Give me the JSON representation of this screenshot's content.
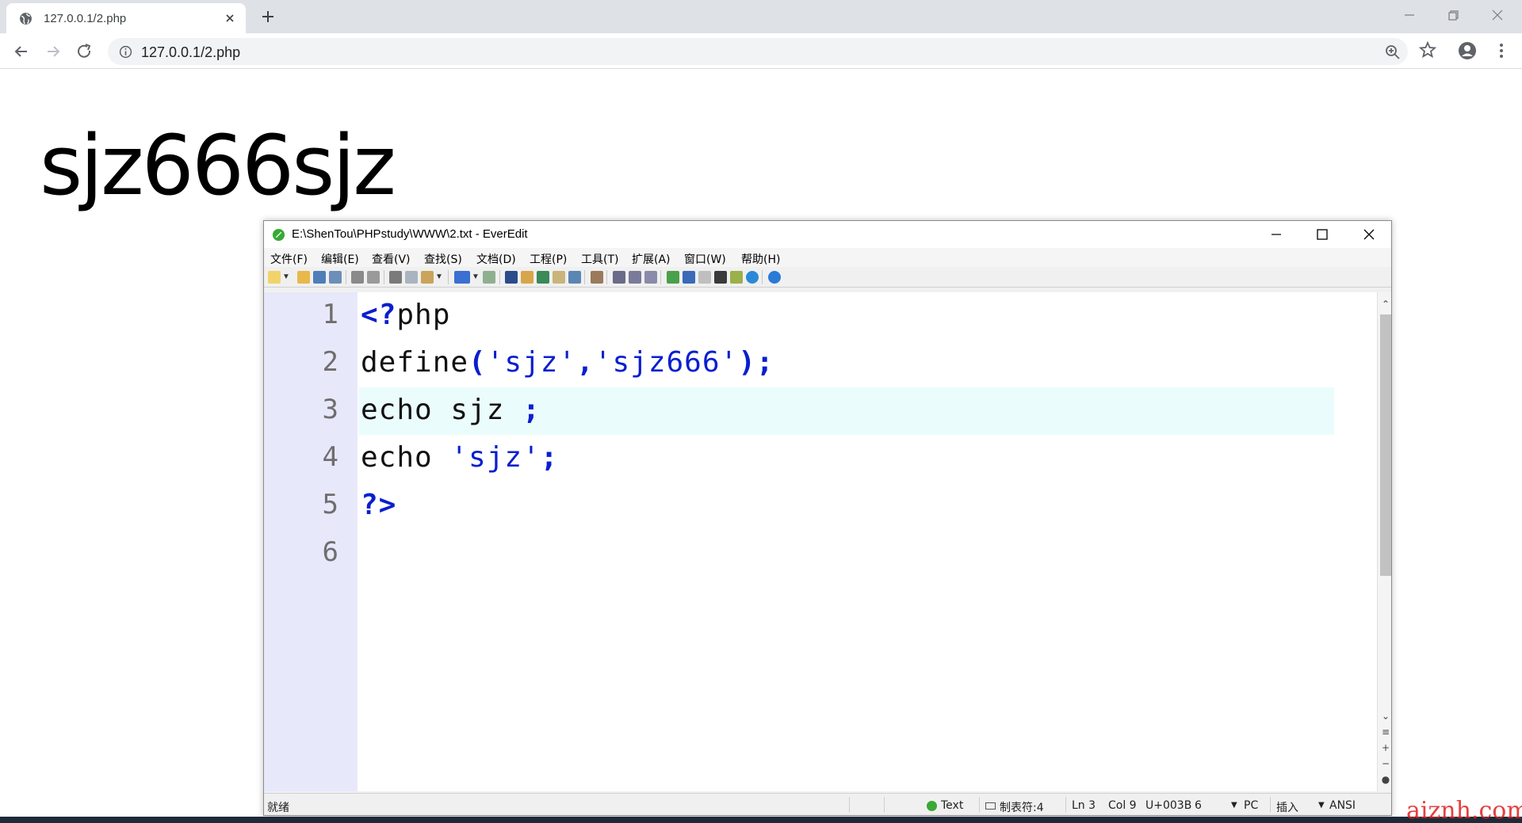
{
  "browser": {
    "tab_title": "127.0.0.1/2.php",
    "url": "127.0.0.1/2.php"
  },
  "page": {
    "output": "sjz666sjz"
  },
  "editor": {
    "title": "E:\\ShenTou\\PHPstudy\\WWW\\2.txt - EverEdit",
    "menu": [
      "文件(F)",
      "编辑(E)",
      "查看(V)",
      "查找(S)",
      "文档(D)",
      "工程(P)",
      "工具(T)",
      "扩展(A)",
      "窗口(W)",
      "帮助(H)"
    ],
    "line_numbers": [
      "1",
      "2",
      "3",
      "4",
      "5",
      "6"
    ],
    "code": {
      "l1_open": "<?",
      "l1_rest": "php",
      "l2_func": "define",
      "l2_open": "(",
      "l2_arg1": "'sjz'",
      "l2_comma": ",",
      "l2_arg2": "'sjz666'",
      "l2_close": ");",
      "l3_text": "echo sjz ",
      "l3_semi": ";",
      "l4_text": "echo ",
      "l4_str": "'sjz'",
      "l4_semi": ";",
      "l5": "?>"
    },
    "status": {
      "ready": "就绪",
      "syntax": "Text",
      "tab": "制表符:4",
      "ln": "Ln 3",
      "col": "Col 9",
      "unicode": "U+003B",
      "num": "6",
      "line_end": "PC",
      "mode": "插入",
      "encoding": "ANSI"
    }
  },
  "watermark": "aiznh.com",
  "colors": {
    "keyword": "#0a1ecf",
    "gutter": "#e8e8fb",
    "current_line": "#ebfcfc"
  }
}
